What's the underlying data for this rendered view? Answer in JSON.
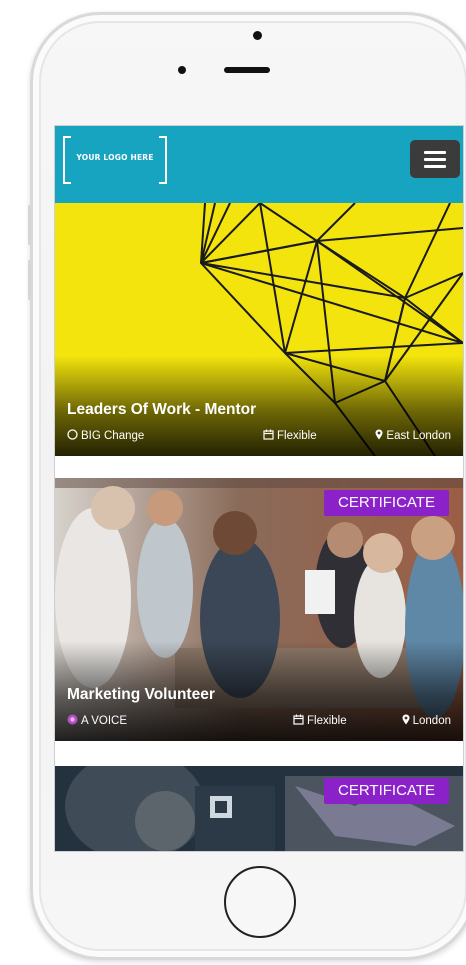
{
  "header": {
    "logo_text": "YOUR LOGO HERE",
    "menu_icon": "hamburger-menu-icon"
  },
  "colors": {
    "header_bg": "#17a4c0",
    "menu_button_bg": "#3b3b3b",
    "certificate_badge": "#8b22c9"
  },
  "opportunities": [
    {
      "title": "Leaders Of Work - Mentor",
      "organisation": "BIG Change",
      "org_icon": "circle-outline-icon",
      "time_commitment": "Flexible",
      "location": "East London",
      "badge": ""
    },
    {
      "title": "Marketing Volunteer",
      "organisation": "A VOICE",
      "org_icon": "purple-circle-logo-icon",
      "time_commitment": "Flexible",
      "location": "London",
      "badge": "CERTIFICATE"
    },
    {
      "badge": "CERTIFICATE"
    }
  ]
}
